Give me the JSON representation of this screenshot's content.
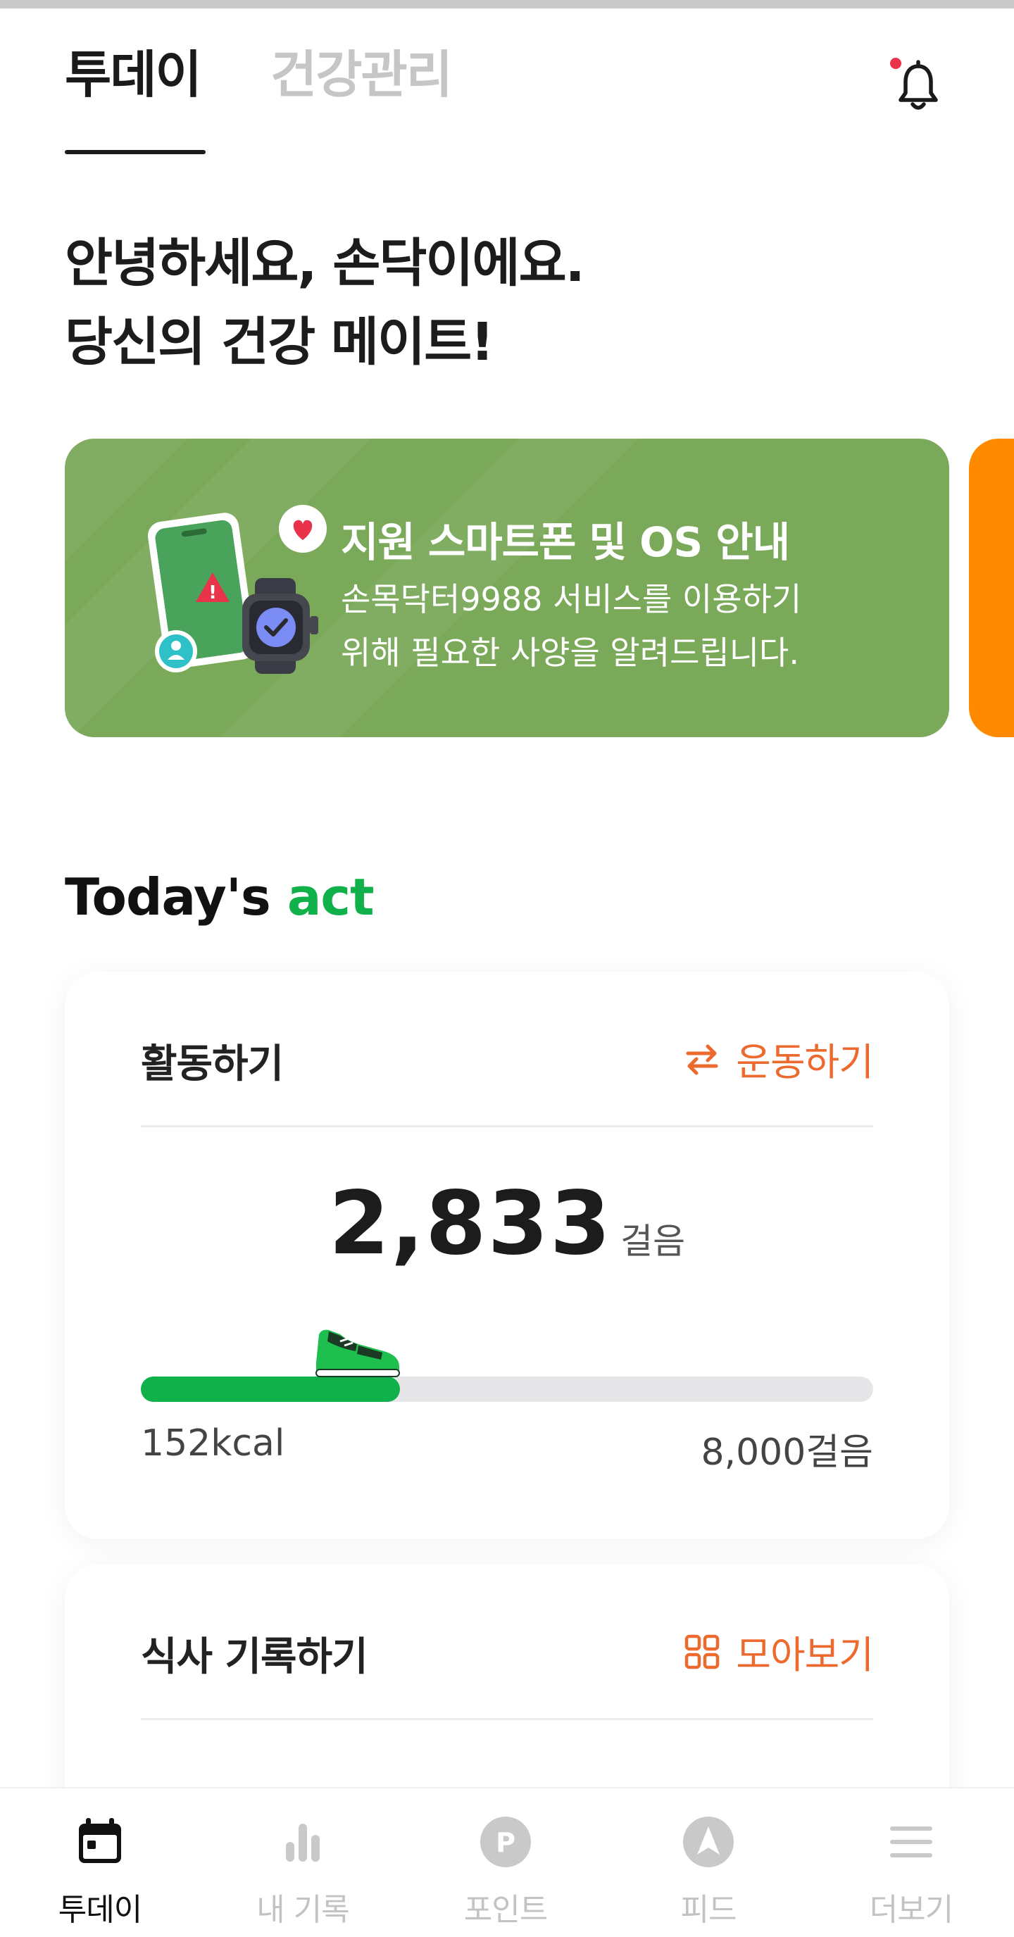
{
  "header": {
    "tabs": [
      {
        "label": "투데이",
        "active": true
      },
      {
        "label": "건강관리",
        "active": false
      }
    ],
    "notification_dot_color": "#e8334a"
  },
  "greeting": {
    "line1": "안녕하세요, 손닥이에요.",
    "line2": "당신의 건강 메이트!"
  },
  "banner": {
    "title": "지원 스마트폰 및 OS 안내",
    "desc_line1": "손목닥터9988 서비스를 이용하기",
    "desc_line2": "위해 필요한 사양을 알려드립니다.",
    "bg_color": "#7ba95a",
    "next_banner_color": "#ff8a00"
  },
  "section": {
    "title_main": "Today's",
    "title_accent": "act",
    "accent_color": "#10b14a"
  },
  "activity_card": {
    "title": "활동하기",
    "action_label": "운동하기",
    "action_icon": "swap-arrows-icon",
    "steps_value": "2,833",
    "steps_unit": "걸음",
    "progress_fraction": 0.354,
    "kcal_label": "152kcal",
    "goal_label": "8,000걸음",
    "accent_color": "#ec6a2d"
  },
  "meal_card": {
    "title": "식사 기록하기",
    "action_label": "모아보기",
    "action_icon": "grid-icon"
  },
  "bottom_nav": {
    "items": [
      {
        "label": "투데이",
        "icon": "calendar-icon",
        "active": true
      },
      {
        "label": "내 기록",
        "icon": "bar-chart-icon",
        "active": false
      },
      {
        "label": "포인트",
        "icon": "point-icon",
        "active": false
      },
      {
        "label": "피드",
        "icon": "feed-icon",
        "active": false
      },
      {
        "label": "더보기",
        "icon": "menu-icon",
        "active": false
      }
    ]
  }
}
